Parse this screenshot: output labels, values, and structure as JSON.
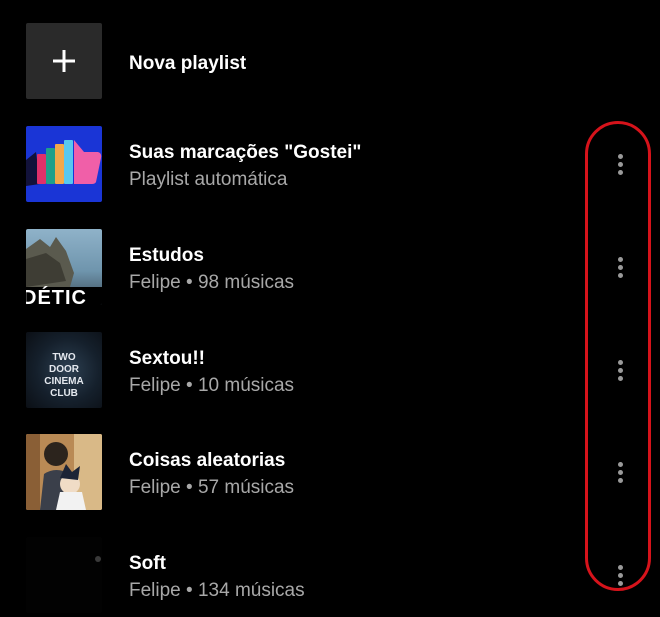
{
  "new_playlist": {
    "label": "Nova playlist",
    "icon": "plus-icon"
  },
  "playlists": [
    {
      "title": "Suas marcações \"Gostei\"",
      "subtitle": "Playlist automática"
    },
    {
      "title": "Estudos",
      "subtitle": "Felipe • 98 músicas",
      "cover_text": "DÉTIC"
    },
    {
      "title": "Sextou!!",
      "subtitle": "Felipe • 10 músicas",
      "cover_text": "TWO DOOR CINEMA CLUB"
    },
    {
      "title": "Coisas aleatorias",
      "subtitle": "Felipe • 57 músicas"
    },
    {
      "title": "Soft",
      "subtitle": "Felipe • 134 músicas"
    }
  ],
  "more_icon": "more-vertical-icon",
  "colors": {
    "background": "#000000",
    "highlight": "#d6131b",
    "liked_cover": "#1a35d6",
    "subtitle": "#a8a8a8"
  }
}
